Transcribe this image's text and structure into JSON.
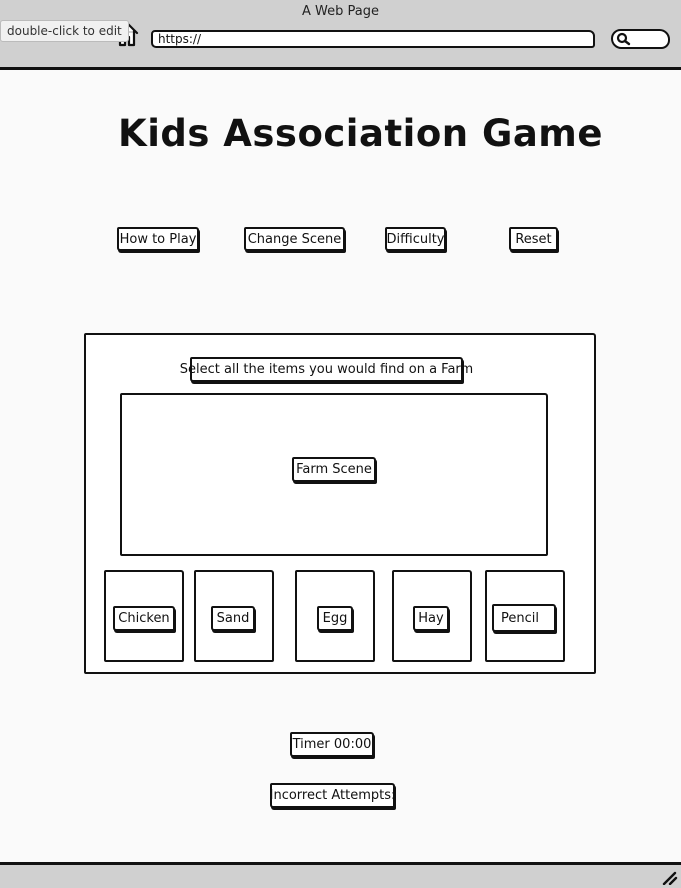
{
  "browser": {
    "window_title": "A Web Page",
    "tooltip": "double-click to edit",
    "url": "https://"
  },
  "page": {
    "title": "Kids Association Game"
  },
  "toolbar": {
    "how_to_play": "How to Play",
    "change_scene": "Change Scene",
    "difficulty": "Difficulty",
    "reset": "Reset"
  },
  "game": {
    "instruction": "Select all the items you would find on a Farm",
    "scene_label": "Farm Scene",
    "items": [
      {
        "label": "Chicken"
      },
      {
        "label": "Sand"
      },
      {
        "label": "Egg"
      },
      {
        "label": "Hay"
      },
      {
        "label": "Pencil"
      }
    ]
  },
  "status": {
    "timer": "Timer 00:00",
    "incorrect_attempts": "Incorrect Attempts:"
  },
  "icons": [
    "back-arrow-icon",
    "forward-arrow-icon",
    "close-icon",
    "home-icon",
    "search-icon",
    "resize-grip-icon"
  ]
}
